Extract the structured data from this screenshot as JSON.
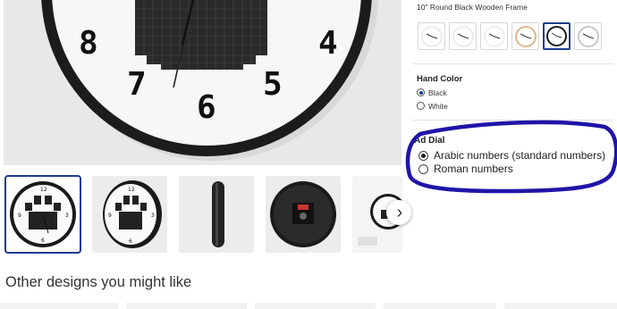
{
  "product": {
    "dial_numbers_visible": [
      "8",
      "4",
      "7",
      "6",
      "5"
    ],
    "thumbnails": [
      {
        "name": "thumb-front-paw",
        "selected": true
      },
      {
        "name": "thumb-angled-paw",
        "selected": false
      },
      {
        "name": "thumb-side-profile",
        "selected": false
      },
      {
        "name": "thumb-back-mechanism",
        "selected": false
      },
      {
        "name": "thumb-room-scene",
        "selected": false
      }
    ],
    "next_icon": "chevron-right-icon",
    "next_glyph": "›"
  },
  "frame": {
    "label": "10\" Round Black Wooden Frame",
    "options": [
      {
        "frame_color": "#ffffff",
        "selected": false
      },
      {
        "frame_color": "#ffffff",
        "selected": false
      },
      {
        "frame_color": "#ffffff",
        "selected": false
      },
      {
        "frame_color": "#d9b88f",
        "selected": false
      },
      {
        "frame_color": "#1a1a1a",
        "selected": true
      },
      {
        "frame_color": "#c9c9c9",
        "selected": false
      }
    ]
  },
  "hand_color": {
    "title": "Hand Color",
    "options": [
      {
        "label": "Black",
        "checked": true
      },
      {
        "label": "White",
        "checked": false
      }
    ]
  },
  "ad_dial": {
    "title": "Ad Dial",
    "options": [
      {
        "label": "Arabic numbers (standard numbers)",
        "checked": true
      },
      {
        "label": "Roman numbers",
        "checked": false
      }
    ]
  },
  "other_designs": {
    "heading": "Other designs you might like"
  },
  "colors": {
    "accent": "#1c3d8f",
    "annotation": "#1f14a8",
    "clock_frame": "#1a1a1a"
  }
}
